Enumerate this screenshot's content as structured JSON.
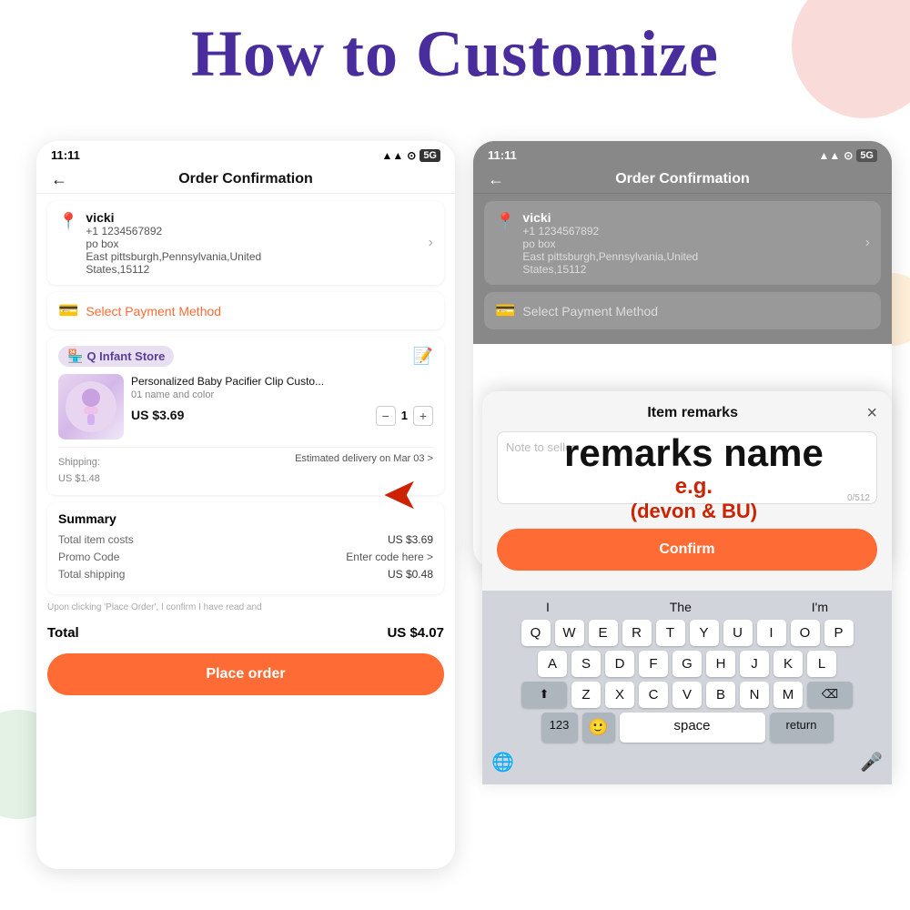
{
  "title": "How to Customize",
  "left_phone": {
    "status_time": "11:11",
    "status_icons": "▲▲ ⊙ 5G",
    "app_bar_title": "Order Confirmation",
    "back_label": "←",
    "address": {
      "name": "vicki",
      "phone": "+1 1234567892",
      "line1": "po box",
      "line2": "East pittsburgh,Pennsylvania,United",
      "line3": "States,15112"
    },
    "payment": {
      "label": "Select Payment Method"
    },
    "store": {
      "name": "Q Infant Store"
    },
    "product": {
      "title": "Personalized Baby Pacifier Clip Custo...",
      "variant": "01 name and color",
      "price": "US $3.69",
      "qty": "1"
    },
    "shipping": {
      "label": "Shipping:",
      "cost": "US $1.48",
      "delivery": "Estimated delivery on Mar 03 >"
    },
    "summary": {
      "title": "Summary",
      "item_costs_label": "Total item costs",
      "item_costs_value": "US $3.69",
      "promo_label": "Promo Code",
      "promo_value": "Enter code here >",
      "shipping_label": "Total shipping",
      "shipping_value": "US $0.48"
    },
    "disclaimer": "Upon clicking 'Place Order', I confirm I have read and",
    "total_label": "Total",
    "total_value": "US $4.07",
    "place_order": "Place order"
  },
  "right_phone": {
    "status_time": "11:11",
    "app_bar_title": "Order Confirmation",
    "back_label": "←",
    "address": {
      "name": "vicki",
      "phone": "+1 1234567892",
      "line1": "po box",
      "line2": "East pittsburgh,Pennsylvania,United",
      "line3": "States,15112"
    },
    "payment_label": "Select Payment Method"
  },
  "remarks_modal": {
    "title": "Item remarks",
    "close": "×",
    "placeholder": "Note to seller",
    "counter": "0/512",
    "confirm": "Confirm",
    "annotation_line1": "remarks name",
    "annotation_line2": "e.g.",
    "annotation_line3": "(devon & BU)"
  },
  "keyboard": {
    "suggestions": [
      "I",
      "The",
      "I'm"
    ],
    "row1": [
      "Q",
      "W",
      "E",
      "R",
      "T",
      "Y",
      "U",
      "I",
      "O",
      "P"
    ],
    "row2": [
      "A",
      "S",
      "D",
      "F",
      "G",
      "H",
      "J",
      "K",
      "L"
    ],
    "row3": [
      "Z",
      "X",
      "C",
      "V",
      "B",
      "N",
      "M"
    ],
    "num_label": "123",
    "space_label": "space",
    "return_label": "return"
  }
}
